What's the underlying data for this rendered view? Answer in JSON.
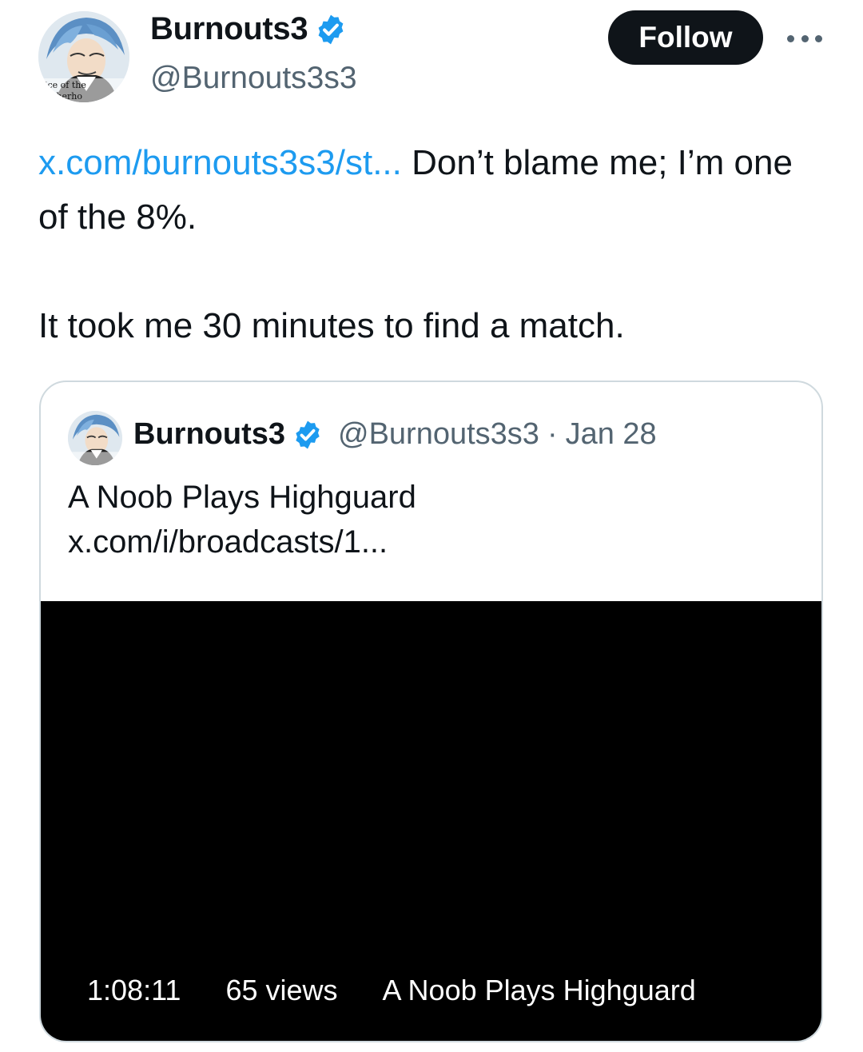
{
  "author": {
    "display_name": "Burnouts3",
    "handle": "@Burnouts3s3",
    "avatar_caption_line1": "ice of the",
    "avatar_caption_line2": "therho"
  },
  "actions": {
    "follow_label": "Follow",
    "more_icon": "more-horizontal-icon"
  },
  "tweet": {
    "link_text": "x.com/burnouts3s3/st...",
    "text_after_link": " Don’t blame me; I’m one of the 8%.",
    "second_paragraph": "It took me 30 minutes to find a match."
  },
  "quoted": {
    "display_name": "Burnouts3",
    "handle": "@Burnouts3s3",
    "separator": "·",
    "date": "Jan 28",
    "title": "A Noob Plays Highguard",
    "link": "x.com/i/broadcasts/1...",
    "video": {
      "duration": "1:08:11",
      "views": "65 views",
      "title": "A Noob Plays Highguard"
    }
  },
  "colors": {
    "link": "#1d9bf0",
    "verified": "#1d9bf0",
    "secondary_text": "#536471",
    "follow_button_bg": "#0f1419"
  }
}
